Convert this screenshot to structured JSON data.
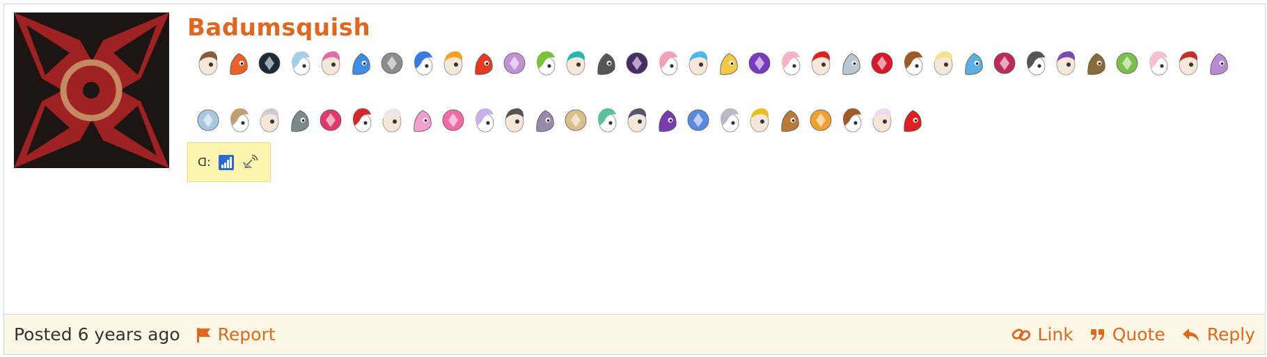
{
  "post": {
    "username": "Badumsquish",
    "user_extra": {
      "label": "ᗡ:",
      "icons": [
        "signal-bars-icon",
        "satellite-dish-icon"
      ]
    },
    "badges": [
      {
        "icon": "brown-hair-pony-badge-icon",
        "color": "#8a5a3a"
      },
      {
        "icon": "orange-mane-pony-badge-icon",
        "color": "#e8622a"
      },
      {
        "icon": "queen-chrysalis-badge-icon",
        "color": "#1b2a35"
      },
      {
        "icon": "crystal-tree-badge-icon",
        "color": "#a8cfe8"
      },
      {
        "icon": "sparkle-confetti-badge-icon",
        "color": "#e26aa8"
      },
      {
        "icon": "moon-circle-badge-icon",
        "color": "#3d8de2"
      },
      {
        "icon": "zecora-badge-icon",
        "color": "#8c8c8c"
      },
      {
        "icon": "verified-wing-badge-icon",
        "color": "#3a7be0"
      },
      {
        "icon": "orange-square-badge-icon",
        "color": "#f5a020"
      },
      {
        "icon": "phoenix-badge-icon",
        "color": "#e63a20"
      },
      {
        "icon": "hot-air-balloon-badge-icon",
        "color": "#c38fd6"
      },
      {
        "icon": "changeling-badge-icon",
        "color": "#7ac23a"
      },
      {
        "icon": "teal-pony-frame-badge-icon",
        "color": "#2ab5b5"
      },
      {
        "icon": "art-supplies-badge-icon",
        "color": "#555555"
      },
      {
        "icon": "shield-crest-badge-icon",
        "color": "#4a2a6a"
      },
      {
        "icon": "orange-pink-pony-badge-icon",
        "color": "#f5a0b4"
      },
      {
        "icon": "rainbow-dash-badge-icon",
        "color": "#4ab8e8"
      },
      {
        "icon": "thread-spool-badge-icon",
        "color": "#f2c84a"
      },
      {
        "icon": "purple-gem-badge-icon",
        "color": "#7a3ac0"
      },
      {
        "icon": "pink-pony-winking-badge-icon",
        "color": "#f5b3c8"
      },
      {
        "icon": "crossed-out-badge-icon",
        "color": "#e02020"
      },
      {
        "icon": "plate-badge-icon",
        "color": "#b8c8d4"
      },
      {
        "icon": "red-heart-gem-badge-icon",
        "color": "#d61a2a"
      },
      {
        "icon": "brown-pony-badge-icon",
        "color": "#9a5a2a"
      },
      {
        "icon": "fluttershy-badge-icon",
        "color": "#f5e28a"
      },
      {
        "icon": "blue-mane-pony-badge-icon",
        "color": "#5ab0e0"
      },
      {
        "icon": "unicorn-glasses-badge-icon",
        "color": "#c02a5a"
      },
      {
        "icon": "equals-sign-badge-icon",
        "color": "#555555"
      },
      {
        "icon": "twilight-sparkle-badge-icon",
        "color": "#7a4ab0"
      },
      {
        "icon": "owl-badge-icon",
        "color": "#8a6a3a"
      },
      {
        "icon": "spike-dragon-badge-icon",
        "color": "#7ac04a"
      },
      {
        "icon": "cake-slice-badge-icon",
        "color": "#f5c0d0"
      },
      {
        "icon": "rooster-badge-icon",
        "color": "#c0302a"
      },
      {
        "icon": "quill-scroll-badge-icon",
        "color": "#b88ad0"
      },
      {
        "icon": "fleur-de-lis-badge-icon",
        "color": "#a8c8e0"
      },
      {
        "icon": "mushroom-pony-badge-icon",
        "color": "#c0a070"
      },
      {
        "icon": "white-creature-badge-icon",
        "color": "#cccccc"
      },
      {
        "icon": "grey-pony-badge-icon",
        "color": "#7a8a8a"
      },
      {
        "icon": "pink-shield-badge-icon",
        "color": "#e03a6a"
      },
      {
        "icon": "big-mac-badge-icon",
        "color": "#d02a2a"
      },
      {
        "icon": "sweetie-belle-badge-icon",
        "color": "#e8e8e8"
      },
      {
        "icon": "cadance-badge-icon",
        "color": "#f0a0d0"
      },
      {
        "icon": "pinkie-pie-badge-icon",
        "color": "#f06aa8"
      },
      {
        "icon": "breezie-badge-icon",
        "color": "#c8b0e8"
      },
      {
        "icon": "octavia-badge-icon",
        "color": "#555555"
      },
      {
        "icon": "maud-pie-badge-icon",
        "color": "#9a8aa8"
      },
      {
        "icon": "tan-pony-badge-icon",
        "color": "#d8c088"
      },
      {
        "icon": "white-pony-mint-badge-icon",
        "color": "#5ac0a0"
      },
      {
        "icon": "photo-finish-badge-icon",
        "color": "#555577"
      },
      {
        "icon": "rarity-badge-icon",
        "color": "#7a3ab0"
      },
      {
        "icon": "trixie-badge-icon",
        "color": "#5a8ae0"
      },
      {
        "icon": "derpy-badge-icon",
        "color": "#b8b8c8"
      },
      {
        "icon": "gold-coin-badge-icon",
        "color": "#e8c020"
      },
      {
        "icon": "squirrel-badge-icon",
        "color": "#b87a3a"
      },
      {
        "icon": "applejack-badge-icon",
        "color": "#f0a030"
      },
      {
        "icon": "paint-brush-badge-icon",
        "color": "#a05a2a"
      },
      {
        "icon": "fleur-pony-badge-icon",
        "color": "#f0d8f0"
      },
      {
        "icon": "apple-cutie-mark-badge-icon",
        "color": "#e02020"
      }
    ]
  },
  "footer": {
    "posted_label": "Posted",
    "posted_time": "6 years ago",
    "report_label": "Report",
    "link_label": "Link",
    "quote_label": "Quote",
    "reply_label": "Reply"
  },
  "colors": {
    "accent": "#e0671f",
    "footer_bg": "#fdf8e6",
    "user_extra_bg": "#fcf5b0"
  }
}
